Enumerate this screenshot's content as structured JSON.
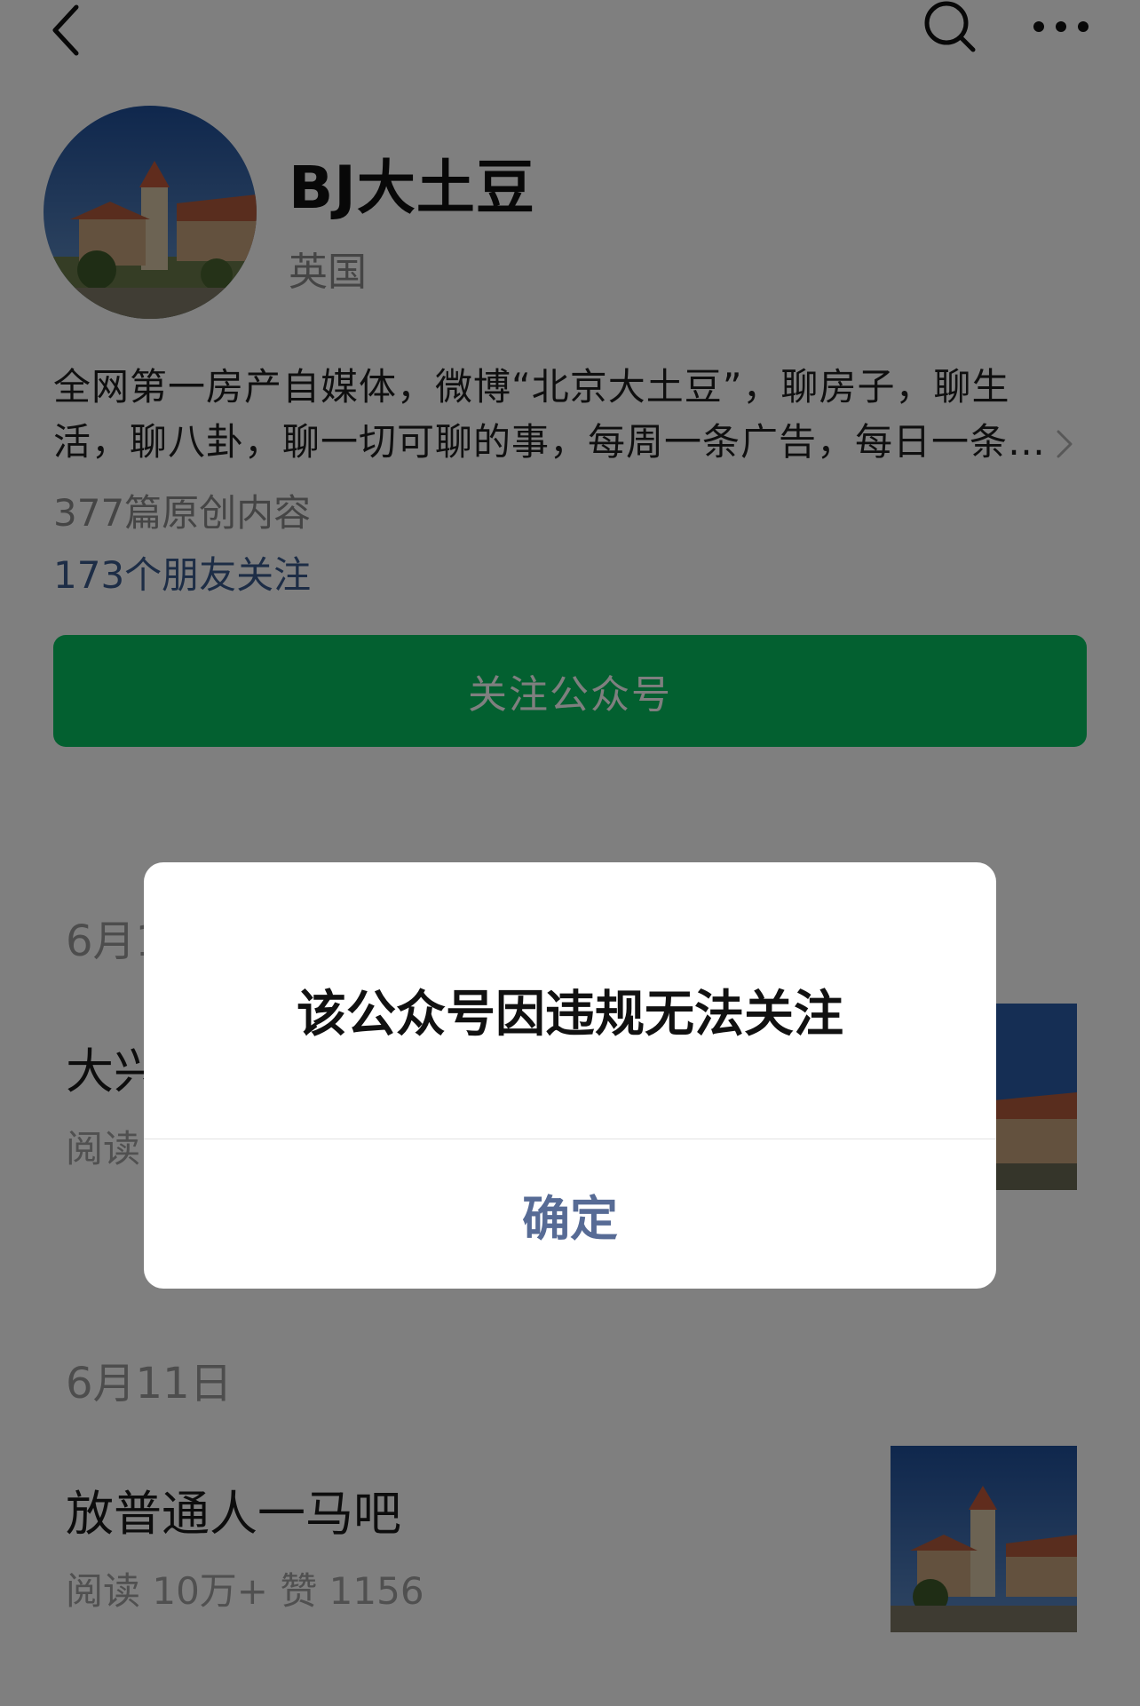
{
  "header": {
    "back_icon": "chevron-left-icon",
    "search_icon": "search-icon",
    "more_icon": "ellipsis-icon"
  },
  "profile": {
    "avatar_icon": "building-photo",
    "name": "BJ大土豆",
    "region": "英国",
    "description": "全网第一房产自媒体，微博“北京大土豆”，聊房子，聊生活，聊八卦，聊一切可聊的事，每周一条广告，每日一条推送，欢迎关注",
    "original_count": "377篇原创内容",
    "friends_following": "173个朋友关注",
    "follow_button": "关注公众号"
  },
  "articles": [
    {
      "date": "6月1",
      "title": "大兴",
      "meta": "阅读"
    },
    {
      "date": "6月11日",
      "title": "放普通人一马吧",
      "meta": "阅读 10万+  赞 1156"
    }
  ],
  "dialog": {
    "message": "该公众号因违规无法关注",
    "confirm": "确定"
  },
  "colors": {
    "follow_green": "#07c160",
    "link_blue": "#576b95",
    "overlay": "rgba(0,0,0,0.5)"
  }
}
